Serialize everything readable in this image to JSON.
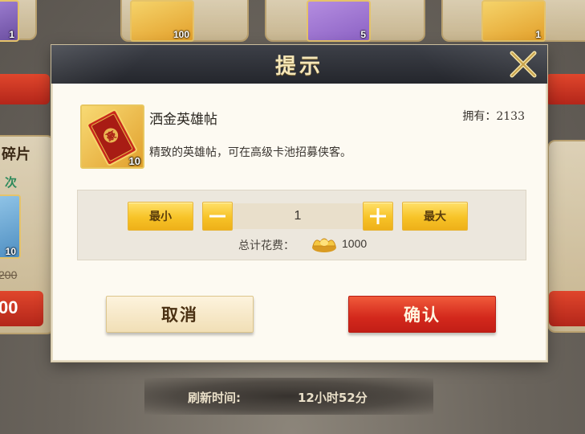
{
  "background": {
    "top_items": [
      {
        "count": "1"
      },
      {
        "count": "100"
      },
      {
        "count": "5"
      },
      {
        "count": "1"
      }
    ],
    "left_card": {
      "title_partial": "碎片",
      "sub_partial": "次",
      "count": "10",
      "old_price": "200",
      "price_partial": "00"
    },
    "refresh": {
      "label": "刷新时间:",
      "value": "12小时52分"
    }
  },
  "dialog": {
    "title": "提示",
    "item": {
      "name": "洒金英雄帖",
      "quantity": "10",
      "owned": "拥有：2133",
      "description": "精致的英雄帖，可在高级卡池招募侠客。",
      "icon": "hero-invitation-card-icon"
    },
    "quantity_selector": {
      "min_label": "最小",
      "max_label": "最大",
      "minus_label": "−",
      "plus_label": "+",
      "value": "1"
    },
    "total": {
      "label": "总计花费：",
      "currency_icon": "gold-ingot-icon",
      "value": "1000"
    },
    "buttons": {
      "cancel": "取消",
      "confirm": "确认"
    }
  },
  "colors": {
    "header": "#2b2d33",
    "gold_button": "#f7c327",
    "confirm_red": "#d3281c",
    "panel": "#ece7dd"
  }
}
